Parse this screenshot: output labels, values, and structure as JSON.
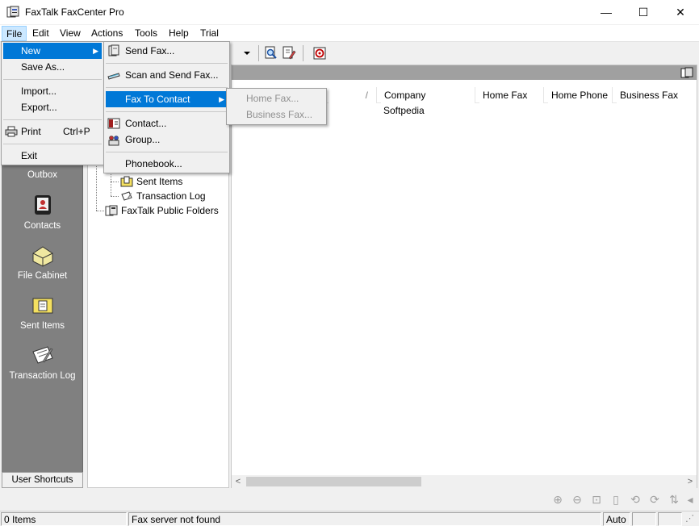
{
  "window": {
    "title": "FaxTalk FaxCenter Pro",
    "minimize": "—",
    "maximize": "☐",
    "close": "✕"
  },
  "menubar": [
    "File",
    "Edit",
    "View",
    "Actions",
    "Tools",
    "Help",
    "Trial"
  ],
  "file_menu": {
    "items": [
      {
        "label": "New",
        "hotkey_char": "N"
      },
      {
        "label": "Save As..."
      },
      {
        "label": "Import..."
      },
      {
        "label": "Export..."
      },
      {
        "label": "Print",
        "shortcut": "Ctrl+P"
      },
      {
        "label": "Exit"
      }
    ]
  },
  "new_submenu": {
    "items": [
      {
        "label": "Send Fax..."
      },
      {
        "label": "Scan and Send Fax..."
      },
      {
        "label": "Fax To Contact"
      },
      {
        "label": "Contact..."
      },
      {
        "label": "Group..."
      },
      {
        "label": "Phonebook..."
      }
    ]
  },
  "fax_to_contact_submenu": {
    "items": [
      {
        "label": "Home Fax..."
      },
      {
        "label": "Business Fax..."
      }
    ]
  },
  "shortcuts": {
    "items": [
      {
        "label": "Outbox",
        "icon": "outbox-icon"
      },
      {
        "label": "Contacts",
        "icon": "contacts-icon"
      },
      {
        "label": "File Cabinet",
        "icon": "file-cabinet-icon"
      },
      {
        "label": "Sent Items",
        "icon": "sent-items-icon"
      },
      {
        "label": "Transaction Log",
        "icon": "transaction-log-icon"
      }
    ],
    "footer": "User Shortcuts"
  },
  "tree": {
    "nodes": [
      {
        "label": "Sent Items"
      },
      {
        "label": "Transaction Log"
      },
      {
        "label": "FaxTalk Public Folders"
      }
    ]
  },
  "list": {
    "sort_indicator": "/",
    "columns": [
      "Company",
      "Home Fax",
      "Home Phone",
      "Business Fax"
    ],
    "rows": [
      {
        "company": "Softpedia",
        "home_fax": "",
        "home_phone": "",
        "business_fax": ""
      }
    ]
  },
  "watermark": "SOFTPEDIA",
  "statusbar": {
    "items": "0 Items",
    "message": "Fax server not found",
    "mode": "Auto"
  },
  "colors": {
    "highlight": "#0078d7",
    "shortcut_bg": "#808080",
    "header_bar": "#a0a0a0"
  }
}
